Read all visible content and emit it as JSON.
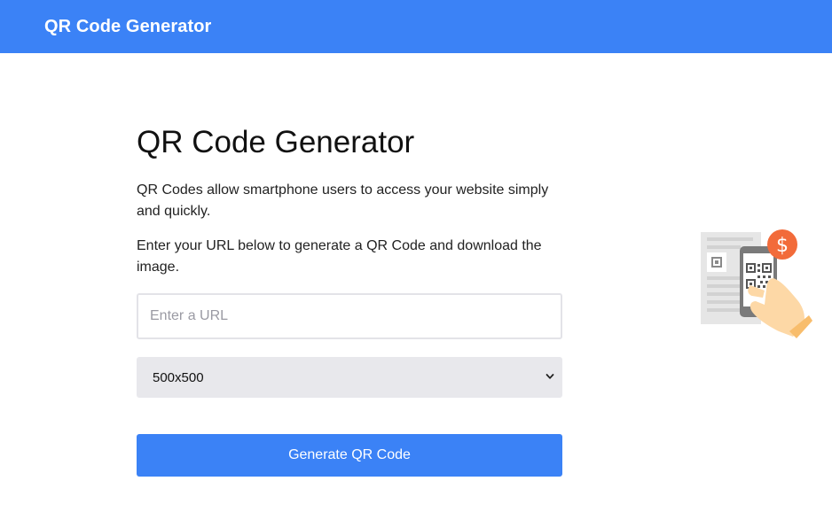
{
  "navbar": {
    "brand": "QR Code Generator"
  },
  "main": {
    "title": "QR Code Generator",
    "paragraph_1": "QR Codes allow smartphone users to access your website simply and quickly.",
    "paragraph_2": "Enter your URL below to generate a QR Code and download the image.",
    "url_input": {
      "placeholder": "Enter a URL",
      "value": ""
    },
    "size_select": {
      "selected": "500x500"
    },
    "generate_button": "Generate QR Code"
  },
  "illustration": {
    "icon": "phone-scanning-qr-illustration",
    "coin_symbol": "$"
  },
  "colors": {
    "primary": "#3b82f6",
    "select_bg": "#e8e8ec",
    "coin": "#f26b3a"
  }
}
